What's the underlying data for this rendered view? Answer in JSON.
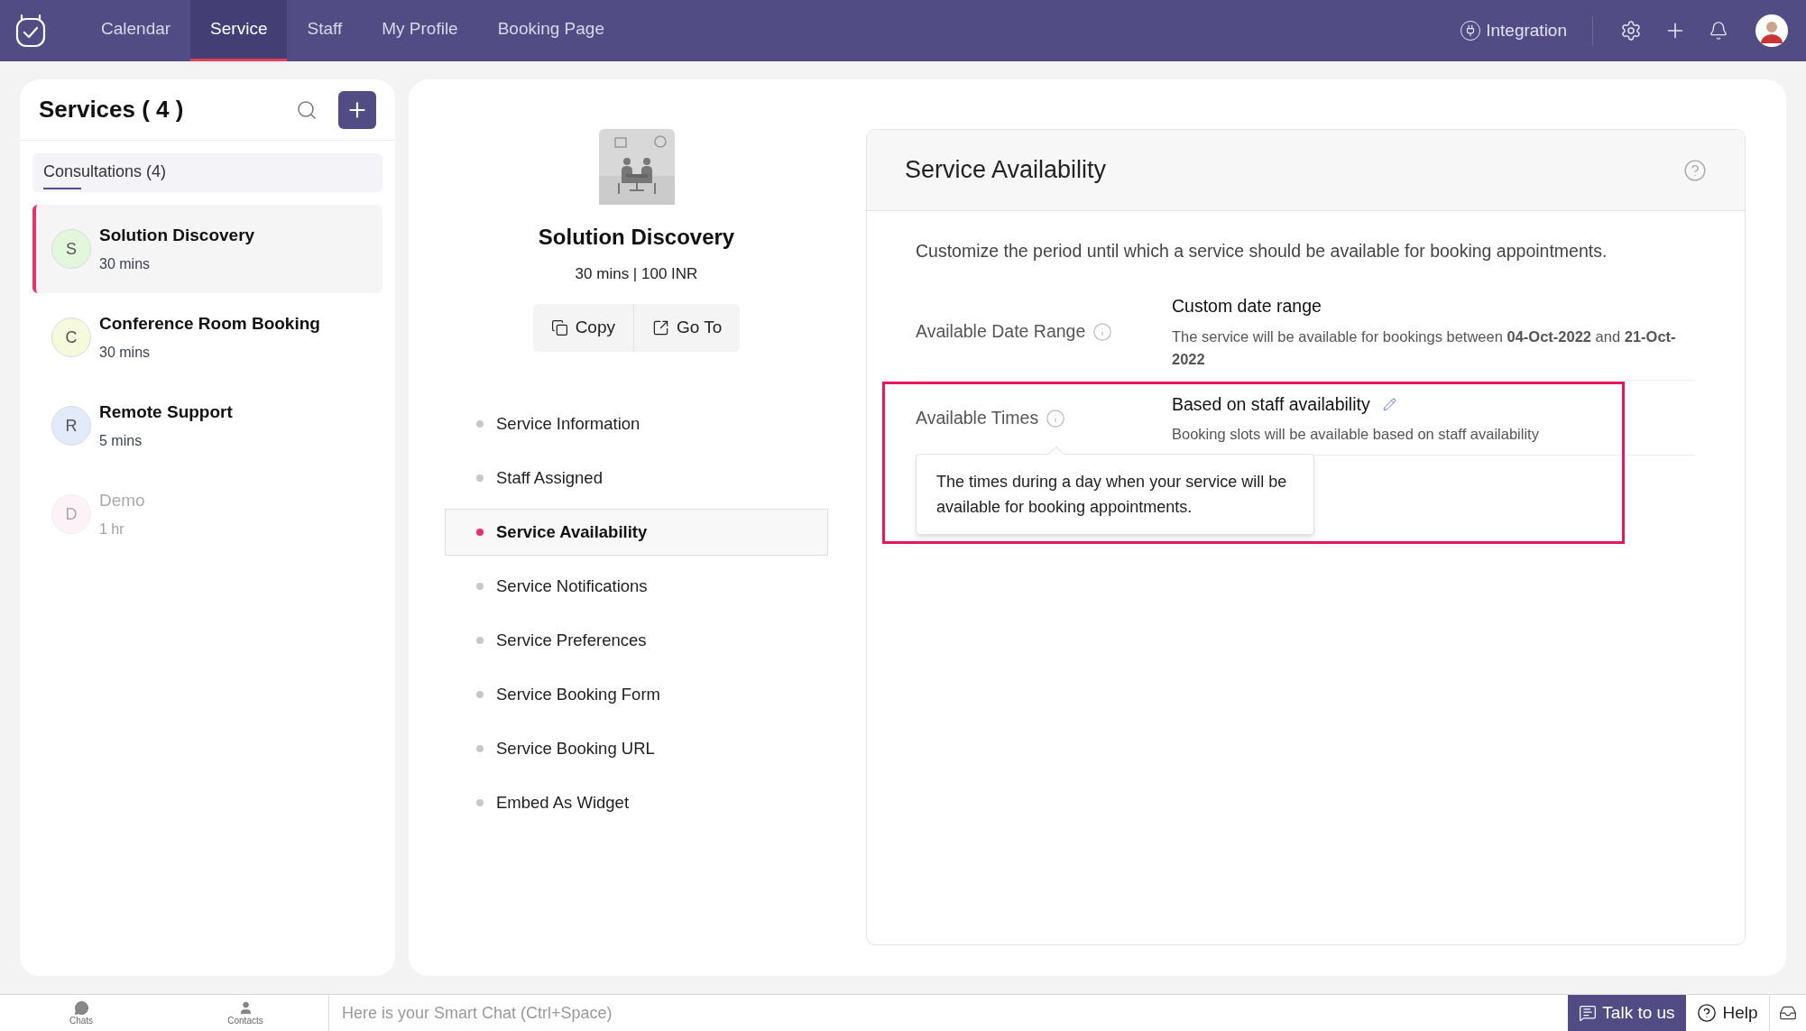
{
  "nav": {
    "tabs": [
      {
        "label": "Calendar",
        "selected": false
      },
      {
        "label": "Service",
        "selected": true
      },
      {
        "label": "Staff",
        "selected": false
      },
      {
        "label": "My Profile",
        "selected": false
      },
      {
        "label": "Booking Page",
        "selected": false
      }
    ],
    "integration": "Integration"
  },
  "services_panel": {
    "title": "Services ( 4 )",
    "category": "Consultations (4)",
    "items": [
      {
        "initial": "S",
        "name": "Solution Discovery",
        "duration": "30 mins",
        "color": "#e3f7dc",
        "selected": true,
        "disabled": false
      },
      {
        "initial": "C",
        "name": "Conference Room Booking",
        "duration": "30 mins",
        "color": "#f6f9dc",
        "selected": false,
        "disabled": false
      },
      {
        "initial": "R",
        "name": "Remote Support",
        "duration": "5 mins",
        "color": "#e3ebfa",
        "selected": false,
        "disabled": false
      },
      {
        "initial": "D",
        "name": "Demo",
        "duration": "1 hr",
        "color": "#fbe6f0",
        "selected": false,
        "disabled": true
      }
    ]
  },
  "detail": {
    "name": "Solution Discovery",
    "meta": "30 mins | 100 INR",
    "actions": [
      {
        "kind": "copy",
        "label": "Copy"
      },
      {
        "kind": "goto",
        "label": "Go To"
      }
    ],
    "menu": [
      {
        "label": "Service Information",
        "selected": false
      },
      {
        "label": "Staff Assigned",
        "selected": false
      },
      {
        "label": "Service Availability",
        "selected": true
      },
      {
        "label": "Service Notifications",
        "selected": false
      },
      {
        "label": "Service Preferences",
        "selected": false
      },
      {
        "label": "Service Booking Form",
        "selected": false
      },
      {
        "label": "Service Booking URL",
        "selected": false
      },
      {
        "label": "Embed As Widget",
        "selected": false
      }
    ]
  },
  "availability": {
    "title": "Service Availability",
    "description": "Customize the period until which a service should be available for booking appointments.",
    "rows": [
      {
        "label": "Available Date Range",
        "value": "Custom date range",
        "note": "The service will be available for bookings between **04-Oct-2022** and **21-Oct-2022**",
        "editable": false
      },
      {
        "label": "Available Times",
        "value": "Based on staff availability",
        "note": "Booking slots will be available based on staff availability",
        "editable": true
      }
    ],
    "tooltip": "The times during a day when your service will be available for booking appointments."
  },
  "bottom_bar": {
    "chats": "Chats",
    "contacts": "Contacts",
    "chat_placeholder": "Here is your Smart Chat (Ctrl+Space)",
    "talk": "Talk to us",
    "help": "Help"
  }
}
